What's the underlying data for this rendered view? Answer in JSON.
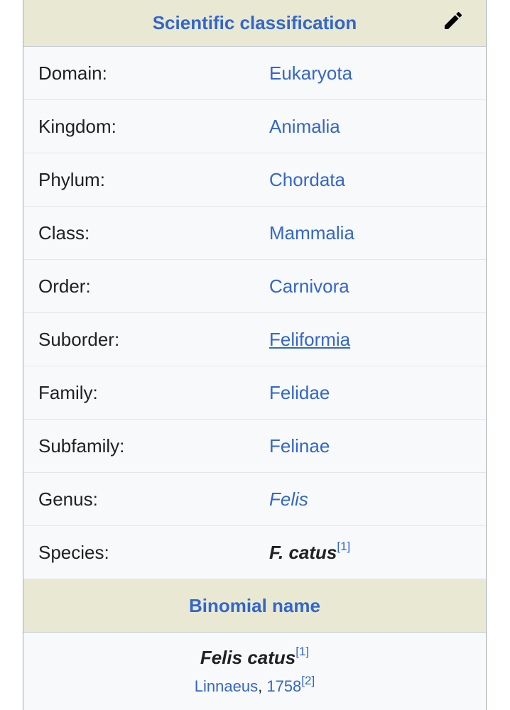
{
  "header": {
    "title": "Scientific classification"
  },
  "rows": [
    {
      "label": "Domain:",
      "value": "Eukaryota"
    },
    {
      "label": "Kingdom:",
      "value": "Animalia"
    },
    {
      "label": "Phylum:",
      "value": "Chordata"
    },
    {
      "label": "Class:",
      "value": "Mammalia"
    },
    {
      "label": "Order:",
      "value": "Carnivora"
    },
    {
      "label": "Suborder:",
      "value": "Feliformia"
    },
    {
      "label": "Family:",
      "value": "Felidae"
    },
    {
      "label": "Subfamily:",
      "value": "Felinae"
    },
    {
      "label": "Genus:",
      "value": "Felis"
    },
    {
      "label": "Species:",
      "value": "F. catus",
      "ref": "[1]"
    }
  ],
  "binomial": {
    "section_title": "Binomial name",
    "name": "Felis catus",
    "name_ref": "[1]",
    "author": "Linnaeus",
    "separator": ", ",
    "year": "1758",
    "year_ref": "[2]"
  },
  "colors": {
    "link": "#3366cc",
    "header_bg": "#e9e9d3",
    "box_bg": "#f8f9fa",
    "text": "#202122"
  },
  "icons": {
    "edit": "pencil-icon"
  }
}
